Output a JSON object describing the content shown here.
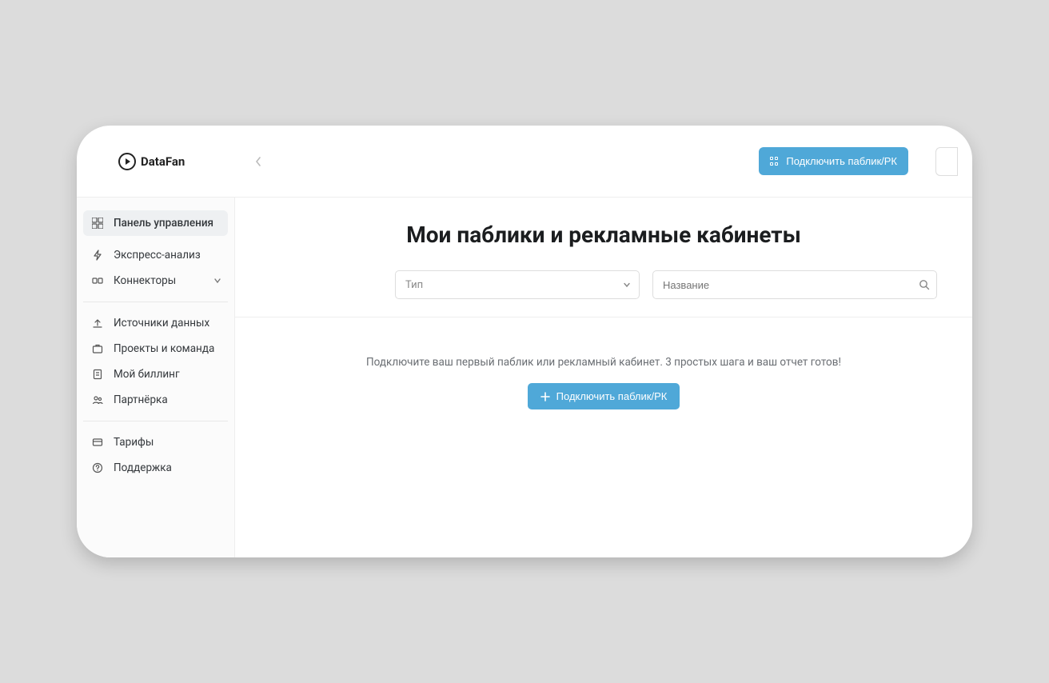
{
  "brand": "DataFan",
  "header": {
    "connect_button": "Подключить паблик/РК"
  },
  "sidebar": {
    "items": [
      {
        "label": "Панель управления",
        "icon": "dashboard"
      },
      {
        "label": "Экспресс-анализ",
        "icon": "bolt"
      },
      {
        "label": "Коннекторы",
        "icon": "plugs",
        "expandable": true
      },
      {
        "label": "Источники данных",
        "icon": "upload"
      },
      {
        "label": "Проекты и команда",
        "icon": "briefcase"
      },
      {
        "label": "Мой биллинг",
        "icon": "receipt"
      },
      {
        "label": "Партнёрка",
        "icon": "people"
      },
      {
        "label": "Тарифы",
        "icon": "card"
      },
      {
        "label": "Поддержка",
        "icon": "help"
      }
    ]
  },
  "main": {
    "title": "Мои паблики и рекламные кабинеты",
    "type_select": {
      "placeholder": "Тип"
    },
    "name_search": {
      "placeholder": "Название"
    },
    "empty_text": "Подключите ваш первый паблик или рекламный кабинет. 3 простых шага и ваш отчет готов!",
    "empty_button": "Подключить паблик/РК"
  }
}
